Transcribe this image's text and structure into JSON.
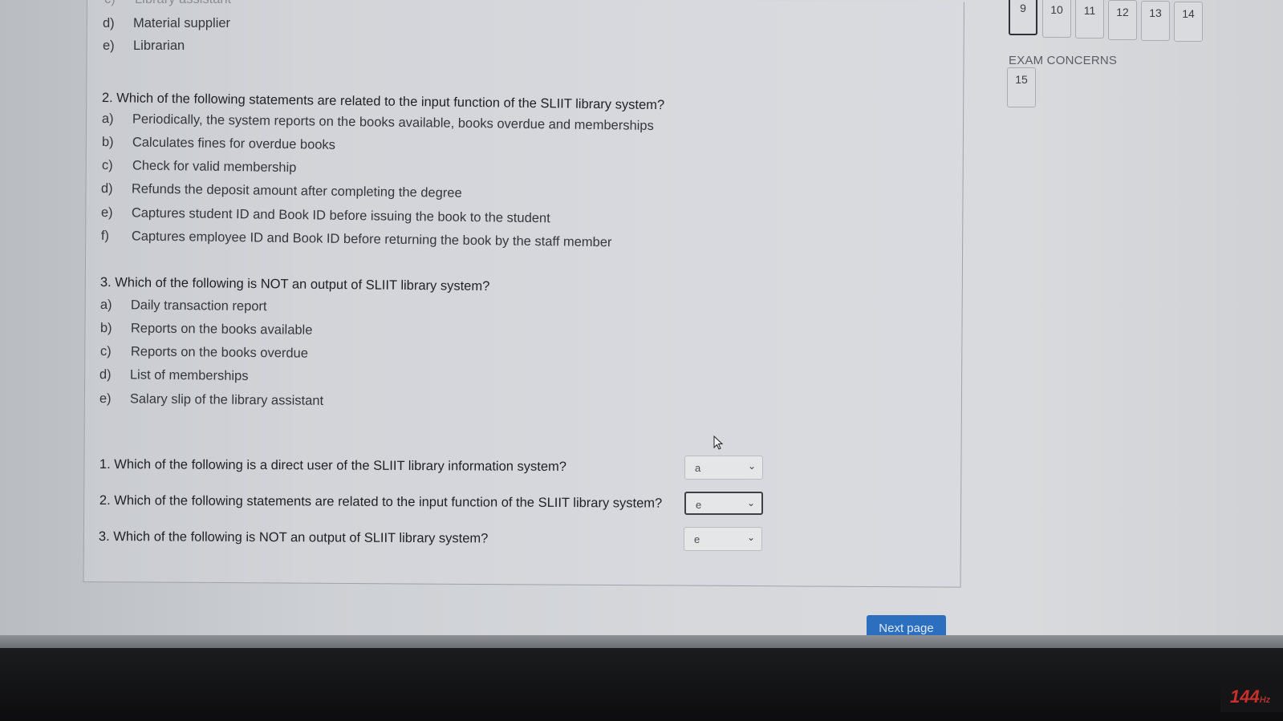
{
  "previous_question_tail": {
    "options": [
      {
        "letter": "c)",
        "text": "Library assistant"
      },
      {
        "letter": "d)",
        "text": "Material supplier"
      },
      {
        "letter": "e)",
        "text": "Librarian"
      }
    ]
  },
  "question2": {
    "title": "2.  Which of the following statements are related to the input function of the SLIIT library system?",
    "options": [
      {
        "letter": "a)",
        "text": "Periodically, the system reports on the books available, books overdue and memberships"
      },
      {
        "letter": "b)",
        "text": "Calculates fines for overdue books"
      },
      {
        "letter": "c)",
        "text": "Check for valid membership"
      },
      {
        "letter": "d)",
        "text": "Refunds the deposit amount after completing the degree"
      },
      {
        "letter": "e)",
        "text": "Captures student ID and Book ID before issuing the book to the student"
      },
      {
        "letter": "f)",
        "text": "Captures employee ID and Book ID before returning the book by the staff member"
      }
    ]
  },
  "question3": {
    "title": "3. Which of the following is NOT an output of SLIIT library system?",
    "options": [
      {
        "letter": "a)",
        "text": "Daily transaction report"
      },
      {
        "letter": "b)",
        "text": "Reports on the books available"
      },
      {
        "letter": "c)",
        "text": "Reports on the books overdue"
      },
      {
        "letter": "d)",
        "text": "List of memberships"
      },
      {
        "letter": "e)",
        "text": "Salary slip of the library assistant"
      }
    ]
  },
  "answers": [
    {
      "label": "1.  Which of the following is a direct user of the SLIIT library information system?",
      "selected": "a"
    },
    {
      "label": "2.  Which of the following statements are related to the input function of the SLIIT library system?",
      "selected": "e"
    },
    {
      "label": "3. Which of the following is NOT an output of SLIIT library system?",
      "selected": "e"
    }
  ],
  "navigation": {
    "question_numbers": [
      "9",
      "10",
      "11",
      "12",
      "13",
      "14"
    ],
    "current": "9",
    "concerns_label": "EXAM CONCERNS",
    "concerns_numbers": [
      "15"
    ]
  },
  "footer": {
    "next_button_label": "Next page"
  },
  "monitor": {
    "refresh_rate": "144",
    "refresh_unit": "Hz"
  },
  "colors": {
    "accent_button": "#2d6fbf",
    "monitor_badge": "#c8302b"
  }
}
